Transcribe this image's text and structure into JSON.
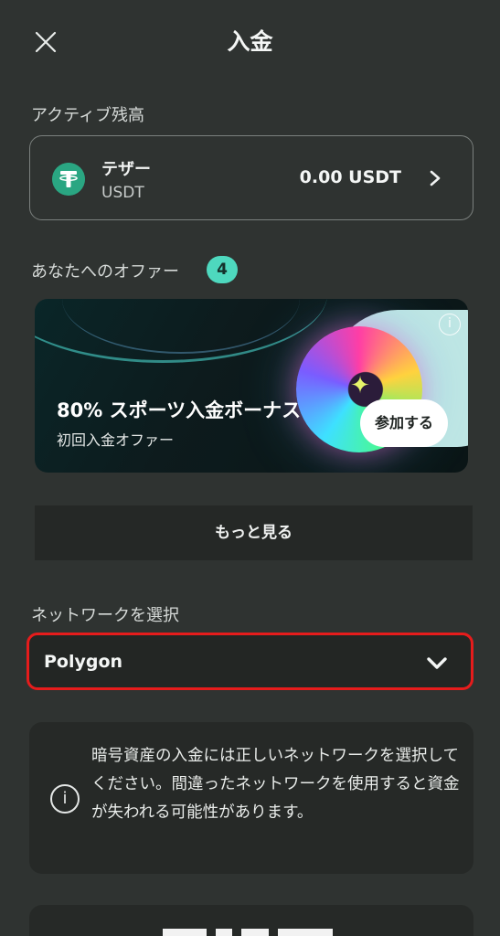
{
  "header": {
    "title": "入金",
    "close_icon": "close-icon"
  },
  "balance": {
    "label": "アクティブ残高",
    "token_name": "テザー",
    "token_symbol": "USDT",
    "amount": "0.00 USDT",
    "token_icon": "tether-icon",
    "token_icon_glyph": "₮",
    "token_color": "#2aa682"
  },
  "offers": {
    "label": "あなたへのオファー",
    "count": "4",
    "banner": {
      "title": "80% スポーツ入金ボーナス",
      "subtitle": "初回入金オファー",
      "join_label": "参加する",
      "info_glyph": "i"
    },
    "more_label": "もっと見る"
  },
  "network": {
    "label": "ネットワークを選択",
    "selected": "Polygon",
    "highlight_color": "#e61c1c"
  },
  "notice": {
    "icon_glyph": "i",
    "text": "暗号資産の入金には正しいネットワークを選択してください。間違ったネットワークを使用すると資金が失われる可能性があります。"
  }
}
